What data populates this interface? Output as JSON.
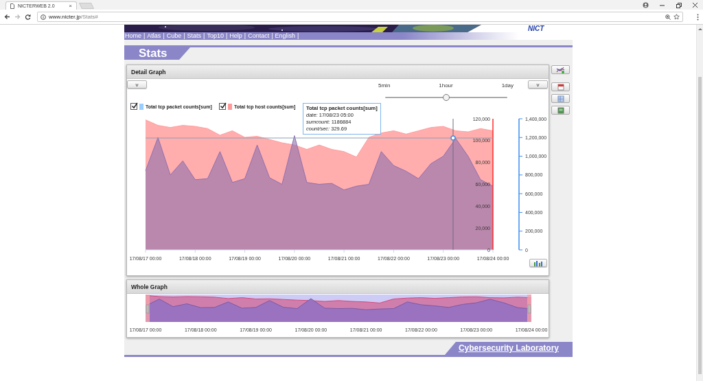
{
  "browser": {
    "tab_title": "NICTERWEB 2.0",
    "tab_close": "×",
    "url_host": "www.nicter.jp",
    "url_path": "/Stats#"
  },
  "header": {
    "logo": "NICT"
  },
  "nav": {
    "separator": "|",
    "items": [
      {
        "label": "Home"
      },
      {
        "label": "Atlas"
      },
      {
        "label": "Cube"
      },
      {
        "label": "Stats"
      },
      {
        "label": "Top10"
      },
      {
        "label": "Help"
      },
      {
        "label": "Contact"
      },
      {
        "label": "English"
      }
    ]
  },
  "page_title": "Stats",
  "detail_graph": {
    "title": "Detail Graph",
    "left_button": "v",
    "right_button": "v",
    "interval_slider": {
      "labels": [
        "5min",
        "1hour",
        "1day"
      ],
      "level": 0.5
    },
    "legend": [
      {
        "checked": true,
        "color": "#99ccff"
      },
      {
        "checked": true,
        "color": "#ff9999"
      }
    ],
    "tooltip": {
      "title": "Total tcp packet counts[sum]",
      "lines": [
        "*date:* 17/08/23 05:00",
        "*sumcount:* 1186884",
        "*count/sec:* 329.69"
      ]
    },
    "chart_data": {
      "type": "area",
      "categories": [
        "17/08/17 00:00",
        null,
        null,
        null,
        "17/08/18 00:00",
        null,
        null,
        null,
        "17/08/19 00:00",
        null,
        null,
        null,
        "17/08/20 00:00",
        null,
        null,
        null,
        "17/08/21 00:00",
        null,
        null,
        null,
        "17/08/22 00:00",
        null,
        null,
        null,
        "17/08/23 00:00",
        null,
        null,
        null,
        "17/08/24 00:00"
      ],
      "ylim": [
        0,
        120000
      ],
      "yticks": [
        {
          "value": 0,
          "label": "0"
        },
        {
          "value": 20000,
          "label": "20,000"
        },
        {
          "value": 40000,
          "label": "40,000"
        },
        {
          "value": 60000,
          "label": "60,000"
        },
        {
          "value": 80000,
          "label": "80,000"
        },
        {
          "value": 100000,
          "label": "100,000"
        },
        {
          "value": 120000,
          "label": "120,000"
        }
      ],
      "y2lim": [
        0,
        1400000
      ],
      "y2ticks": [
        {
          "value": 0,
          "label": "0"
        },
        {
          "value": 200000,
          "label": "200,000"
        },
        {
          "value": 400000,
          "label": "400,000"
        },
        {
          "value": 600000,
          "label": "600,000"
        },
        {
          "value": 800000,
          "label": "800,000"
        },
        {
          "value": 1000000,
          "label": "1,000,000"
        },
        {
          "value": 1200000,
          "label": "1,200,000"
        },
        {
          "value": 1400000,
          "label": "1,400,000"
        }
      ],
      "series": [
        {
          "name": "Total tcp packet counts[sum]",
          "color": "#8e6fae",
          "axis": "y2",
          "values": [
            845000,
            1200000,
            800000,
            950000,
            750000,
            760000,
            1050000,
            720000,
            760000,
            1120000,
            770000,
            700000,
            1220000,
            720000,
            700000,
            710000,
            640000,
            680000,
            700000,
            1050000,
            900000,
            840000,
            760000,
            920000,
            1000000,
            1190000,
            1000000,
            750000,
            680000
          ]
        },
        {
          "name": "Total tcp host counts[sum]",
          "color": "#ff9f9f",
          "values": [
            119000,
            114000,
            112000,
            114000,
            113000,
            111000,
            105000,
            109000,
            103000,
            104000,
            101000,
            98000,
            96000,
            92000,
            96000,
            92000,
            90000,
            85000,
            103000,
            107000,
            109000,
            106000,
            109000,
            112000,
            113000,
            109000,
            108000,
            111000,
            109000
          ]
        }
      ]
    }
  },
  "whole_graph": {
    "title": "Whole Graph",
    "x_labels": [
      "17/08/17 00:00",
      "17/08/18 00:00",
      "17/08/19 00:00",
      "17/08/20 00:00",
      "17/08/21 00:00",
      "17/08/22 00:00",
      "17/08/23 00:00",
      "17/08/24 00:00"
    ]
  },
  "footer": {
    "title": "Cybersecurity Laboratory"
  }
}
